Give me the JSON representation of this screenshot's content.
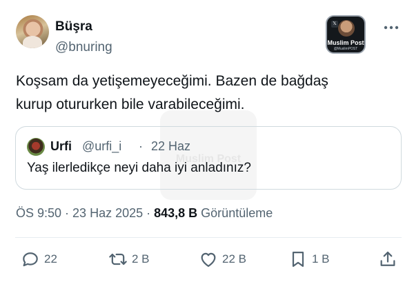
{
  "author": {
    "name": "Büşra",
    "handle": "@bnuring",
    "avatar_icon": "profile-photo"
  },
  "watermark_badge": {
    "title": "Muslim Post",
    "subtitle": "@MuslimPOST",
    "x_icon": "𝕏"
  },
  "tweet": {
    "line1": "Koşsam da yetişemeyeceğimi. Bazen de bağdaş",
    "line2": "kurup otururken bile varabileceğimi."
  },
  "quote": {
    "name": "Urfi",
    "handle": "@urfi_i",
    "separator": "·",
    "date": "22 Haz",
    "text": "Yaş ilerledikçe neyi daha iyi anladınız?"
  },
  "meta": {
    "time": "ÖS 9:50",
    "sep1": " · ",
    "date": "23 Haz 2025",
    "sep2": " · ",
    "views_count": "843,8 B",
    "views_label": " Görüntüleme"
  },
  "actions": {
    "replies": "22",
    "reposts": "2 B",
    "likes": "22 B",
    "bookmarks": "1 B"
  },
  "background_watermark": "Muslim Post",
  "colors": {
    "text_primary": "#0f1419",
    "text_secondary": "#536471",
    "border": "#cfd9de",
    "background": "#ffffff"
  }
}
